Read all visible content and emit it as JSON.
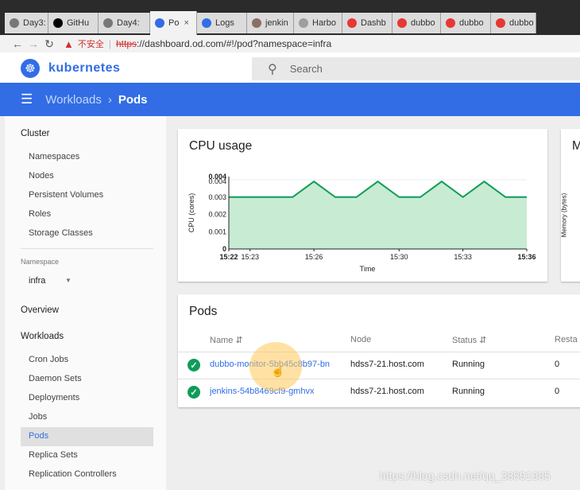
{
  "browser": {
    "tabs": [
      {
        "label": "Day3:",
        "icon": "document-icon",
        "color": "#777777"
      },
      {
        "label": "GitHu",
        "icon": "github-icon",
        "color": "#000000"
      },
      {
        "label": "Day4:",
        "icon": "document-icon",
        "color": "#777777"
      },
      {
        "label": "Po",
        "icon": "kubernetes-icon",
        "color": "#326de6",
        "active": true
      },
      {
        "label": "Logs",
        "icon": "kubernetes-icon",
        "color": "#326de6"
      },
      {
        "label": "jenkin",
        "icon": "jenkins-icon",
        "color": "#8d6e63"
      },
      {
        "label": "Harbo",
        "icon": "harbor-icon",
        "color": "#9e9e9e"
      },
      {
        "label": "Dashb",
        "icon": "dubbo-icon",
        "color": "#e53935"
      },
      {
        "label": "dubbo",
        "icon": "dubbo-icon",
        "color": "#e53935"
      },
      {
        "label": "dubbo",
        "icon": "dubbo-icon",
        "color": "#e53935"
      },
      {
        "label": "dubbo",
        "icon": "dubbo-icon",
        "color": "#e53935"
      }
    ],
    "insecure_label": "不安全",
    "url_scheme": "https",
    "url_rest": "://dashboard.od.com/#!/pod?namespace=infra"
  },
  "header": {
    "brand": "kubernetes",
    "search_placeholder": "Search"
  },
  "toolbar": {
    "crumb_parent": "Workloads",
    "crumb_current": "Pods"
  },
  "sidebar": {
    "cluster_header": "Cluster",
    "cluster_items": [
      "Namespaces",
      "Nodes",
      "Persistent Volumes",
      "Roles",
      "Storage Classes"
    ],
    "namespace_label": "Namespace",
    "namespace_value": "infra",
    "overview": "Overview",
    "workloads_header": "Workloads",
    "workload_items": [
      "Cron Jobs",
      "Daemon Sets",
      "Deployments",
      "Jobs",
      "Pods",
      "Replica Sets",
      "Replication Controllers"
    ],
    "selected_item": "Pods"
  },
  "cpu_card": {
    "title": "CPU usage",
    "second_card_title_fragment": "M",
    "second_card_ylabel": "Memory (bytes)"
  },
  "chart_data": {
    "type": "area",
    "title": "CPU usage",
    "xlabel": "Time",
    "ylabel": "CPU (cores)",
    "ylim": [
      0,
      0.004
    ],
    "yticks": [
      "0.004",
      "0.004",
      "0.003",
      "0.002",
      "0.001",
      "0"
    ],
    "xticks": [
      "15:22",
      "15:23",
      "15:26",
      "15:30",
      "15:33",
      "15:36"
    ],
    "x": [
      "15:22",
      "15:25",
      "15:26",
      "15:27",
      "15:28",
      "15:29",
      "15:30",
      "15:31",
      "15:32",
      "15:33",
      "15:34",
      "15:35",
      "15:36"
    ],
    "series": [
      {
        "values": [
          0.003,
          0.003,
          0.0039,
          0.003,
          0.003,
          0.0039,
          0.003,
          0.003,
          0.0039,
          0.003,
          0.0039,
          0.003,
          0.003
        ],
        "color": "#0f9d58",
        "fill": "#c8ebd3"
      }
    ],
    "grid": true
  },
  "pods_card": {
    "title": "Pods",
    "columns": [
      "Name",
      "Node",
      "Status",
      "Resta"
    ],
    "rows": [
      {
        "name": "dubbo-monitor-5bb45c8b97-bn",
        "node": "hdss7-21.host.com",
        "status": "Running",
        "restarts": "0"
      },
      {
        "name": "jenkins-54b8469cf9-gmhvx",
        "node": "hdss7-21.host.com",
        "status": "Running",
        "restarts": "0"
      }
    ]
  },
  "watermark": "https://blog.csdn.net/qq_38891985"
}
